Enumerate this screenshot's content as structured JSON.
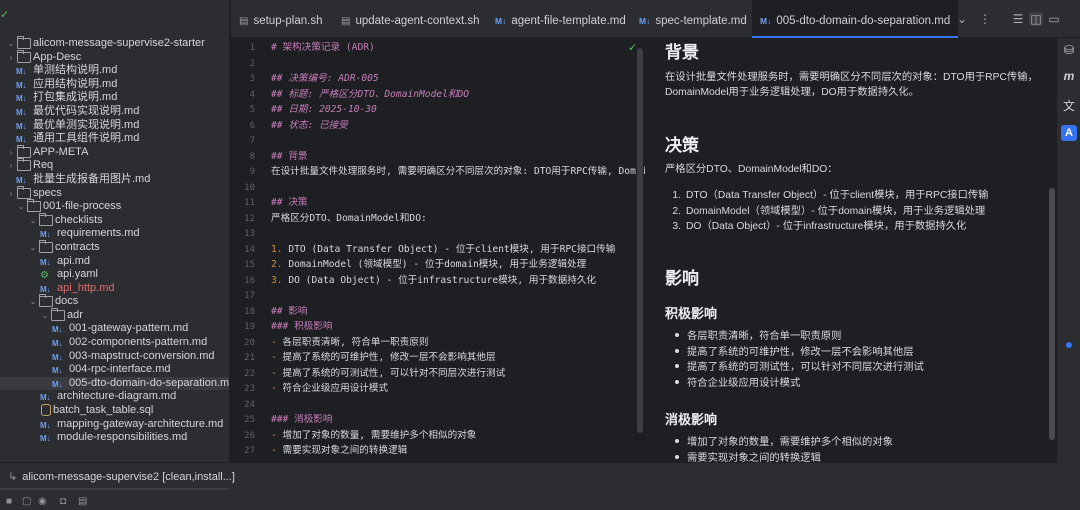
{
  "project_tree": {
    "rows": [
      {
        "label": "alicom-message-supervise2-starter",
        "depth": 0,
        "type": "folder",
        "open": true,
        "bold": true
      },
      {
        "label": "App-Desc",
        "depth": 0,
        "type": "folder",
        "open": false
      },
      {
        "label": "单测结构说明.md",
        "depth": 1,
        "type": "md"
      },
      {
        "label": "应用结构说明.md",
        "depth": 1,
        "type": "md"
      },
      {
        "label": "打包集成说明.md",
        "depth": 1,
        "type": "md"
      },
      {
        "label": "最优代码实现说明.md",
        "depth": 1,
        "type": "md"
      },
      {
        "label": "最优单测实现说明.md",
        "depth": 1,
        "type": "md"
      },
      {
        "label": "通用工具组件说明.md",
        "depth": 1,
        "type": "md"
      },
      {
        "label": "APP-META",
        "depth": 0,
        "type": "folder"
      },
      {
        "label": "Req",
        "depth": 0,
        "type": "folder"
      },
      {
        "label": "批量生成报备用图片.md",
        "depth": 1,
        "type": "md"
      },
      {
        "label": "specs",
        "depth": 0,
        "type": "folder"
      },
      {
        "label": "001-file-process",
        "depth": 1,
        "type": "folder",
        "open": true
      },
      {
        "label": "checklists",
        "depth": 2,
        "type": "folder",
        "open": true
      },
      {
        "label": "requirements.md",
        "depth": 3,
        "type": "md"
      },
      {
        "label": "contracts",
        "depth": 2,
        "type": "folder",
        "open": true
      },
      {
        "label": "api.md",
        "depth": 3,
        "type": "md"
      },
      {
        "label": "api.yaml",
        "depth": 3,
        "type": "yaml"
      },
      {
        "label": "api_http.md",
        "depth": 3,
        "type": "md",
        "red": true
      },
      {
        "label": "docs",
        "depth": 2,
        "type": "folder",
        "open": true
      },
      {
        "label": "adr",
        "depth": 3,
        "type": "folder",
        "open": true
      },
      {
        "label": "001-gateway-pattern.md",
        "depth": 4,
        "type": "md"
      },
      {
        "label": "002-components-pattern.md",
        "depth": 4,
        "type": "md"
      },
      {
        "label": "003-mapstruct-conversion.md",
        "depth": 4,
        "type": "md"
      },
      {
        "label": "004-rpc-interface.md",
        "depth": 4,
        "type": "md"
      },
      {
        "label": "005-dto-domain-do-separation.md",
        "depth": 4,
        "type": "md",
        "selected": true
      },
      {
        "label": "architecture-diagram.md",
        "depth": 3,
        "type": "md"
      },
      {
        "label": "batch_task_table.sql",
        "depth": 3,
        "type": "sql"
      },
      {
        "label": "mapping-gateway-architecture.md",
        "depth": 3,
        "type": "md"
      },
      {
        "label": "module-responsibilities.md",
        "depth": 3,
        "type": "md"
      }
    ]
  },
  "tabs": [
    {
      "label": "setup-plan.sh",
      "kind": "sh"
    },
    {
      "label": "update-agent-context.sh",
      "kind": "sh"
    },
    {
      "label": "agent-file-template.md",
      "kind": "md"
    },
    {
      "label": "spec-template.md",
      "kind": "md"
    },
    {
      "label": "005-dto-domain-do-separation.md",
      "kind": "md",
      "active": true
    }
  ],
  "code_lines": [
    {
      "n": "1",
      "text": "# 架构决策记录 (ADR)",
      "style": "h"
    },
    {
      "n": "2",
      "text": "",
      "style": "t"
    },
    {
      "n": "3",
      "text": "## 决策编号: ADR-005",
      "style": "hi"
    },
    {
      "n": "4",
      "text": "## 标题: 严格区分DTO、DomainModel和DO",
      "style": "hi"
    },
    {
      "n": "5",
      "text": "## 日期: 2025-10-30",
      "style": "hi"
    },
    {
      "n": "6",
      "text": "## 状态: 已接受",
      "style": "hi"
    },
    {
      "n": "7",
      "text": "",
      "style": "t"
    },
    {
      "n": "8",
      "text": "## 背景",
      "style": "h"
    },
    {
      "n": "9",
      "text": "在设计批量文件处理服务时, 需要明确区分不同层次的对象: DTO用于RPC传输, DomainMod",
      "style": "t"
    },
    {
      "n": "10",
      "text": "",
      "style": "t"
    },
    {
      "n": "11",
      "text": "## 决策",
      "style": "h"
    },
    {
      "n": "12",
      "text": "严格区分DTO、DomainModel和DO:",
      "style": "t"
    },
    {
      "n": "13",
      "text": "",
      "style": "t"
    },
    {
      "n": "14",
      "mark": "1.",
      "text": " DTO (Data Transfer Object) - 位于client模块, 用于RPC接口传输",
      "style": "list"
    },
    {
      "n": "15",
      "mark": "2.",
      "text": " DomainModel (领域模型) - 位于domain模块, 用于业务逻辑处理",
      "style": "list"
    },
    {
      "n": "16",
      "mark": "3.",
      "text": " DO (Data Object) - 位于infrastructure模块, 用于数据持久化",
      "style": "list"
    },
    {
      "n": "17",
      "text": "",
      "style": "t"
    },
    {
      "n": "18",
      "text": "## 影响",
      "style": "h"
    },
    {
      "n": "19",
      "text": "### 积极影响",
      "style": "h"
    },
    {
      "n": "20",
      "mark": "-",
      "text": " 各层职责清晰, 符合单一职责原则",
      "style": "bul"
    },
    {
      "n": "21",
      "mark": "-",
      "text": " 提高了系统的可维护性, 修改一层不会影响其他层",
      "style": "bul"
    },
    {
      "n": "22",
      "mark": "-",
      "text": " 提高了系统的可测试性, 可以针对不同层次进行测试",
      "style": "bul"
    },
    {
      "n": "23",
      "mark": "-",
      "text": " 符合企业级应用设计模式",
      "style": "bul"
    },
    {
      "n": "24",
      "text": "",
      "style": "t"
    },
    {
      "n": "25",
      "text": "### 消极影响",
      "style": "h"
    },
    {
      "n": "26",
      "mark": "-",
      "text": " 增加了对象的数量, 需要维护多个相似的对象",
      "style": "bul"
    },
    {
      "n": "27",
      "mark": "-",
      "text": " 需要实现对象之间的转换逻辑",
      "style": "bul"
    }
  ],
  "preview": {
    "h_background": "背景",
    "p_background": "在设计批量文件处理服务时，需要明确区分不同层次的对象：DTO用于RPC传输，DomainModel用于业务逻辑处理，DO用于数据持久化。",
    "h_decision": "决策",
    "p_decision": "严格区分DTO、DomainModel和DO：",
    "decision_items": [
      "DTO（Data Transfer Object）- 位于client模块，用于RPC接口传输",
      "DomainModel（领域模型）- 位于domain模块，用于业务逻辑处理",
      "DO（Data Object）- 位于infrastructure模块，用于数据持久化"
    ],
    "h_impact": "影响",
    "h_positive": "积极影响",
    "positive_items": [
      "各层职责清晰，符合单一职责原则",
      "提高了系统的可维护性，修改一层不会影响其他层",
      "提高了系统的可测试性，可以针对不同层次进行测试",
      "符合企业级应用设计模式"
    ],
    "h_negative": "消极影响",
    "negative_items": [
      "增加了对象的数量，需要维护多个相似的对象",
      "需要实现对象之间的转换逻辑"
    ]
  },
  "run_panel": {
    "label": "alicom-message-supervise2 [clean,install...]"
  },
  "colors": {
    "accent": "#3574f0",
    "heading": "#c77dbb",
    "number": "#d38b3a",
    "ok": "#5fb865"
  }
}
